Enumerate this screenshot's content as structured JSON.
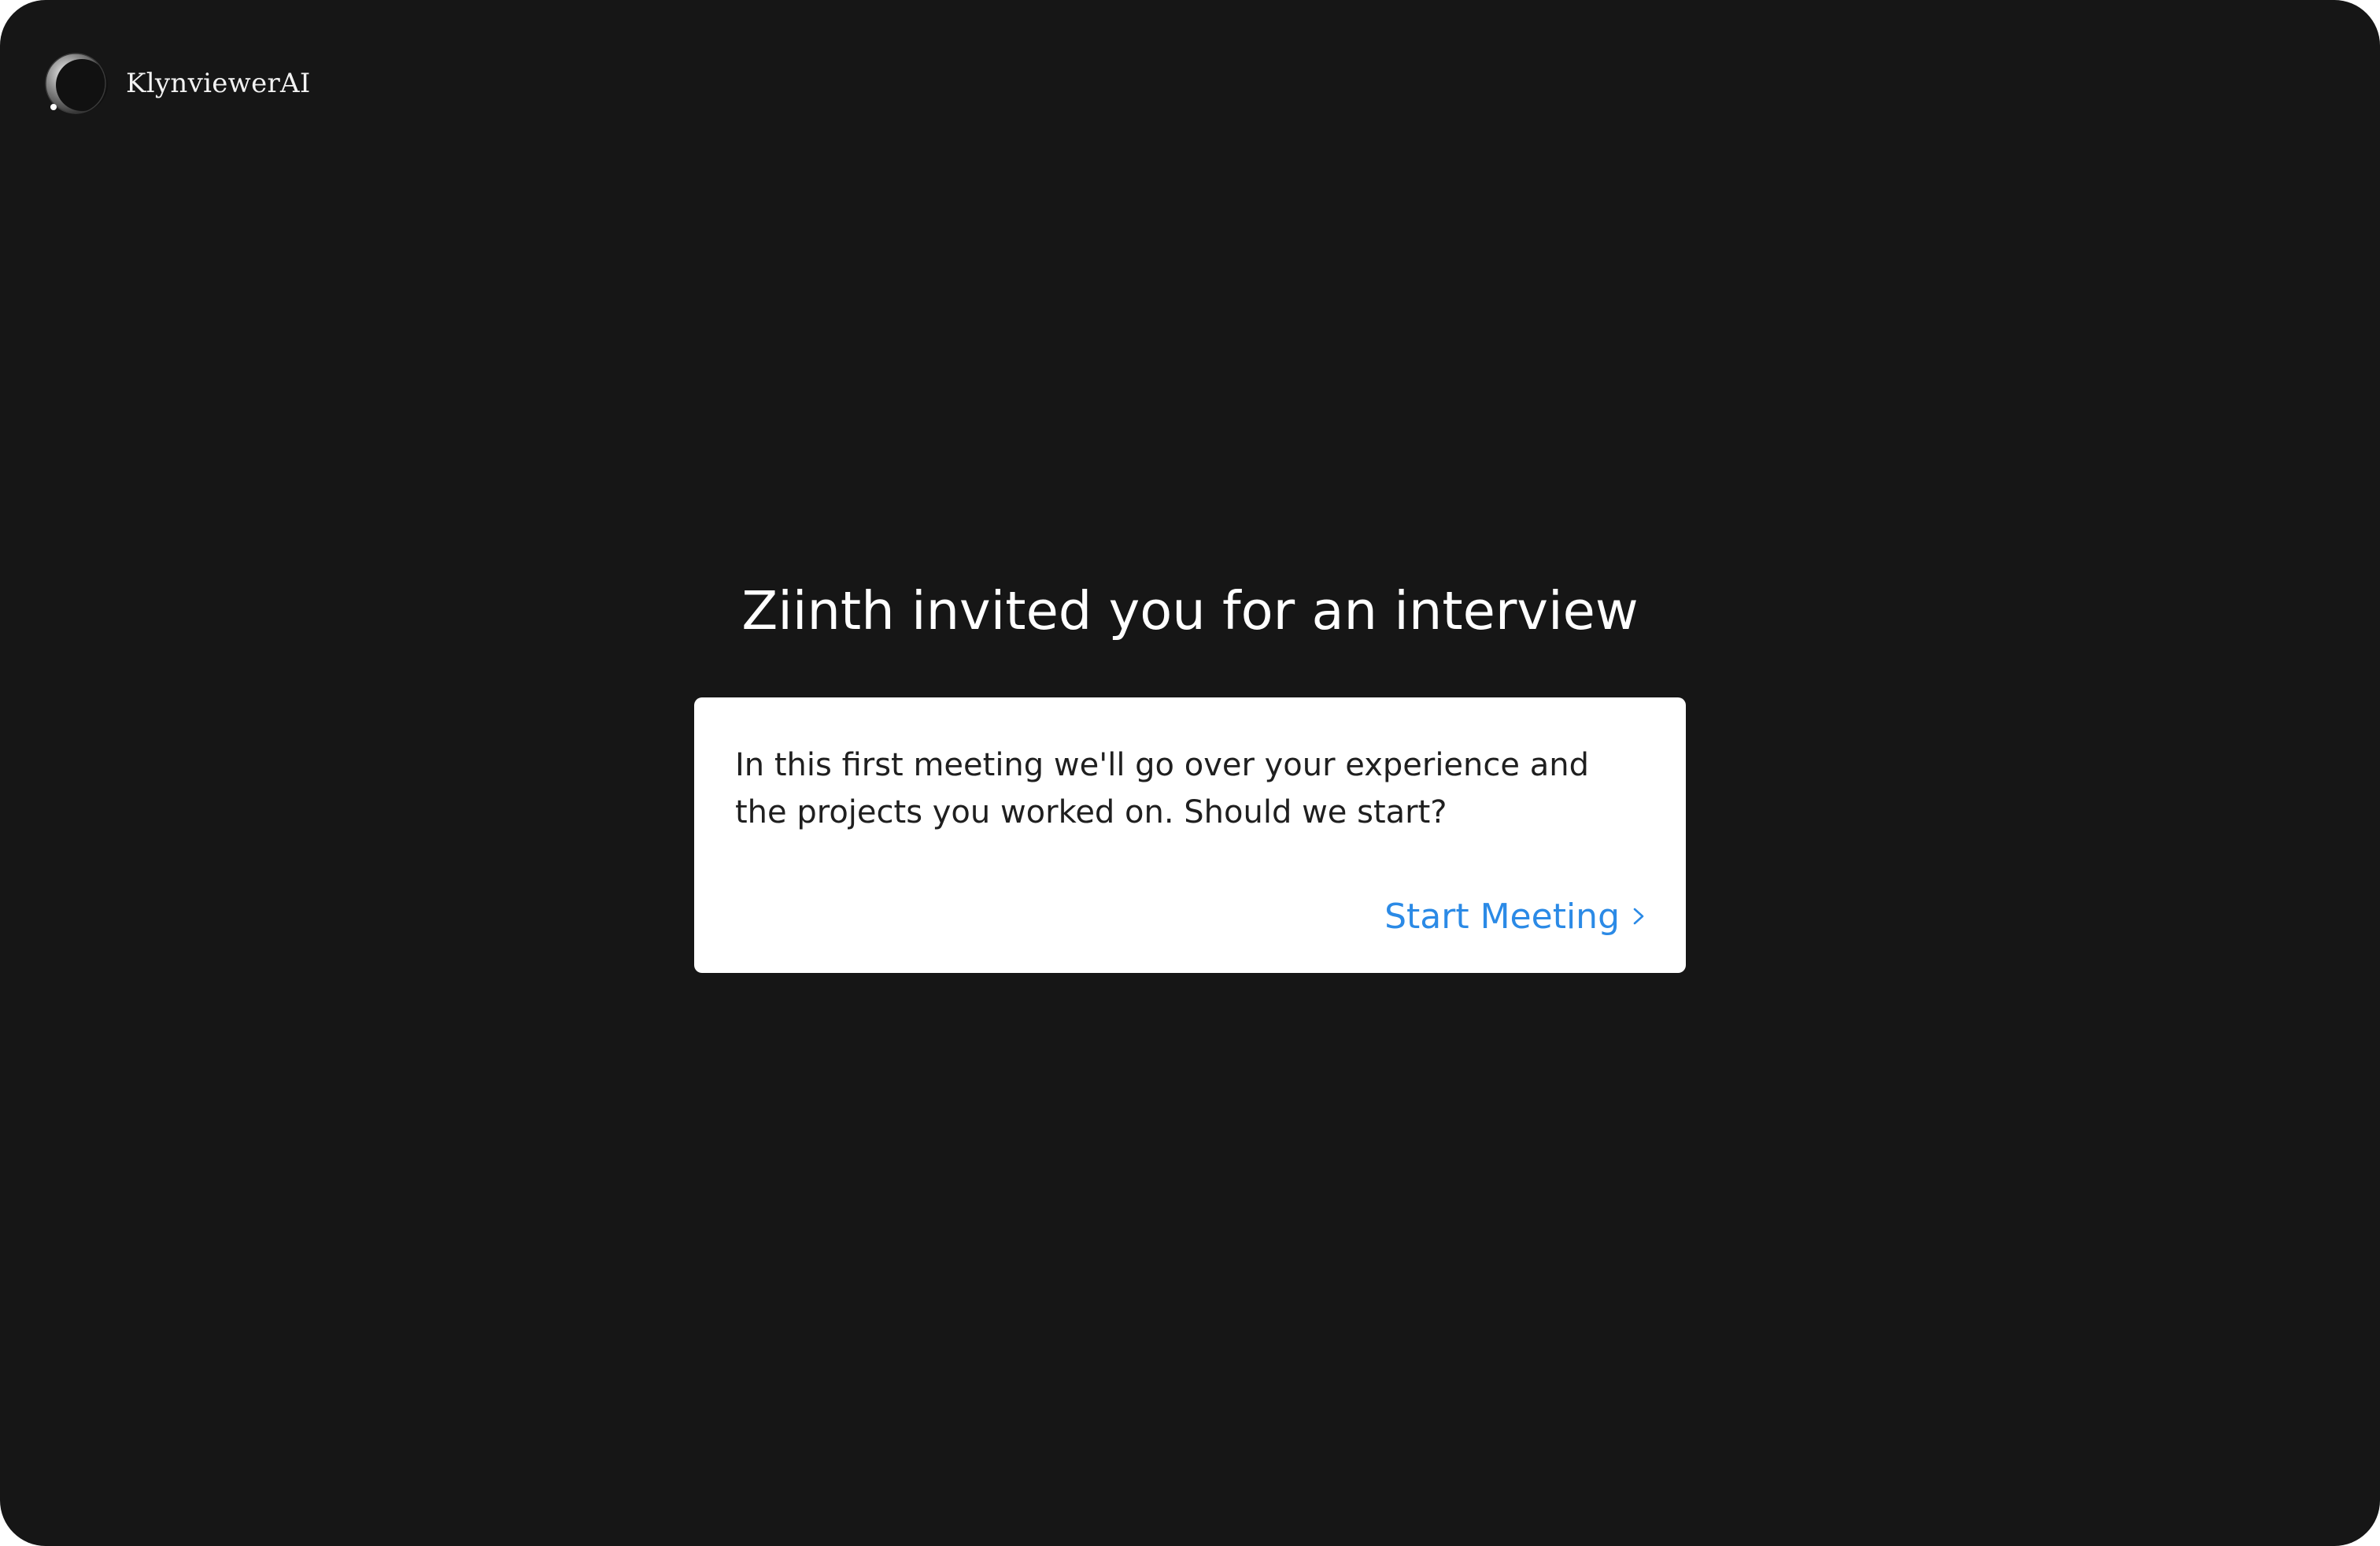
{
  "brand": {
    "name": "KlynviewerAI",
    "logo_icon": "moon-logo-icon"
  },
  "invite": {
    "headline": "Ziinth invited you for an interview",
    "message": "In this first meeting we'll go over your experience and the projects you worked on. Should we start?",
    "start_label": "Start Meeting",
    "start_icon": "chevron-right-icon"
  },
  "colors": {
    "background": "#161616",
    "card": "#ffffff",
    "accent": "#2b8ae6",
    "text_on_dark": "#ffffff"
  }
}
